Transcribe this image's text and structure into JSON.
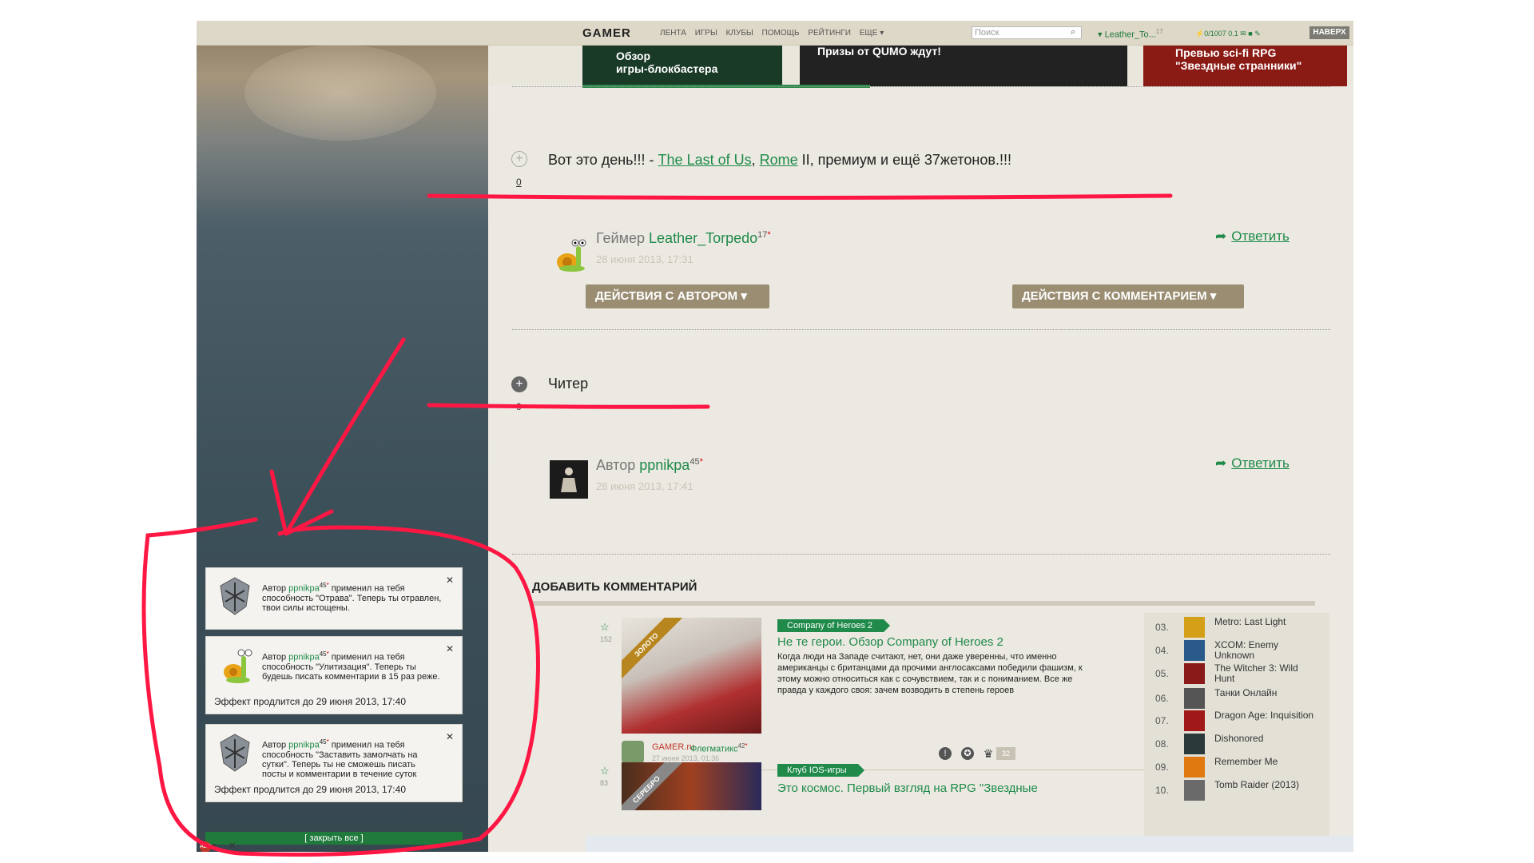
{
  "topnav": {
    "logo": "GAMER",
    "links": [
      "ЛЕНТА",
      "ИГРЫ",
      "КЛУБЫ",
      "ПОМОЩЬ",
      "РЕЙТИНГИ",
      "ЕЩЕ ▾"
    ],
    "search_placeholder": "Поиск",
    "user": "Leather_To...",
    "user_level": "17",
    "stats": "0/1007  0.1",
    "top_button": "НАВЕРХ"
  },
  "banners": {
    "b1": "Обзор\nигры-блокбастера",
    "b2": "Призы от QUMO ждут!",
    "b3": "Превью sci-fi RPG\n\"Звездные странники\""
  },
  "comment1": {
    "count": "0",
    "text_before": "Вот это день!!! - ",
    "link1": "The Last of Us",
    "sep": ", ",
    "link2": "Rome",
    "text_after": " II, премиум и ещё 37жетонов.!!!",
    "role": "Геймер",
    "author": "Leather_Torpedo",
    "level": "17",
    "star": "*",
    "date": "28 июня 2013, 17:31",
    "reply": "Ответить",
    "btn_author": "ДЕЙСТВИЯ С АВТОРОМ ▾",
    "btn_comment": "ДЕЙСТВИЯ С КОММЕНТАРИЕМ ▾"
  },
  "comment2": {
    "count": "0",
    "text": "Читер",
    "role": "Автор",
    "author": "ppnikpa",
    "level": "45",
    "star": "*",
    "date": "28 июня 2013, 17:41",
    "reply": "Ответить"
  },
  "add_comment": "ДОБАВИТЬ КОММЕНТАРИЙ",
  "news": [
    {
      "ribbon": "ЗОЛОТО",
      "count": "152",
      "tag": "Company of Heroes 2",
      "title": "Не те герои. Обзор Company of Heroes 2",
      "desc": "Когда люди на Западе считают, нет, они даже уверенны, что именно американцы с британцами да прочими англосаксами победили фашизм, к этому можно относиться как с сочувствием, так и с пониманием. Все же правда у каждого своя: зачем возводить в степень героев",
      "source": "GAMER.ru",
      "author": "Флегматикс",
      "author_level": "42",
      "date": "27 июня 2013, 01:36",
      "badge": "32"
    },
    {
      "ribbon": "СЕРЕБРО",
      "count": "83",
      "tag": "Клуб IOS-игры",
      "title": "Это космос. Первый взгляд на RPG \"Звездные"
    }
  ],
  "ranking": [
    {
      "num": "03.",
      "name": "Metro: Last Light",
      "color": "#d4a017"
    },
    {
      "num": "04.",
      "name": "XCOM: Enemy Unknown",
      "color": "#2a5a8a"
    },
    {
      "num": "05.",
      "name": "The Witcher 3: Wild Hunt",
      "color": "#8a1a1a"
    },
    {
      "num": "06.",
      "name": "Танки Онлайн",
      "color": "#555555"
    },
    {
      "num": "07.",
      "name": "Dragon Age: Inquisition",
      "color": "#a01818"
    },
    {
      "num": "08.",
      "name": "Dishonored",
      "color": "#2a3a3a"
    },
    {
      "num": "09.",
      "name": "Remember Me",
      "color": "#e07a10"
    },
    {
      "num": "10.",
      "name": "Tomb Raider (2013)",
      "color": "#6a6a6a"
    }
  ],
  "popups": [
    {
      "prefix": "Автор ",
      "nick": "ppnikpa",
      "level": "45",
      "star": "*",
      "text": " применил на тебя способность \"Отрава\". Теперь ты отравлен, твои силы истощены.",
      "effect": ""
    },
    {
      "prefix": "Автор ",
      "nick": "ppnikpa",
      "level": "45",
      "star": "*",
      "text": " применил на тебя способность \"Улитизация\". Теперь ты будешь писать комментарии в 15 раз реже.",
      "effect": "Эффект продлится до 29 июня 2013, 17:40"
    },
    {
      "prefix": "Автор ",
      "nick": "ppnikpa",
      "level": "45",
      "star": "*",
      "text": " применил на тебя способность \"Заставить замолчать на сутки\". Теперь ты не сможешь писать посты и комментарии в течение суток",
      "effect": "Эффект продлится до 29 июня 2013, 17:40"
    }
  ],
  "close_all": "[ закрыть все ]",
  "colors": {
    "accent": "#1f8a4a",
    "annotation": "#ff1744",
    "button": "#9a8d72"
  }
}
